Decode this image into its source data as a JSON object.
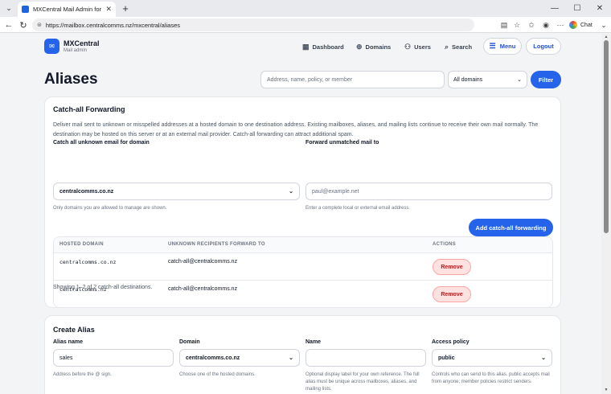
{
  "browser": {
    "tab_title": "MXCentral Mail Admin for CCL",
    "url": "https://mailbox.centralcomms.nz/mxcentral/aliases",
    "chat_label": "Chat"
  },
  "header": {
    "brand_name": "MXCentral",
    "brand_sub": "Mail admin",
    "nav": [
      {
        "label": "Dashboard",
        "icon": "dashboard-icon"
      },
      {
        "label": "Domains",
        "icon": "globe-icon"
      },
      {
        "label": "Users",
        "icon": "users-icon"
      },
      {
        "label": "Search",
        "icon": "search-icon"
      }
    ],
    "menu_label": "Menu",
    "logout_label": "Logout"
  },
  "page": {
    "title": "Aliases",
    "search_placeholder": "Address, name, policy, or member",
    "domain_filter_value": "All domains",
    "filter_label": "Filter"
  },
  "catchall": {
    "title": "Catch-all Forwarding",
    "description": "Deliver mail sent to unknown or misspelled addresses at a hosted domain to one destination address. Existing mailboxes, aliases, and mailing lists continue to receive their own mail normally. The destination may be hosted on this server or at an external mail provider. Catch-all forwarding can attract additional spam.",
    "domain_label": "Catch all unknown email for domain",
    "domain_value": "centralcomms.co.nz",
    "domain_help": "Only domains you are allowed to manage are shown.",
    "forward_label": "Forward unmatched mail to",
    "forward_placeholder": "paul@example.net",
    "forward_help": "Enter a complete local or external email address.",
    "add_label": "Add catch-all forwarding",
    "columns": [
      "HOSTED DOMAIN",
      "UNKNOWN RECIPIENTS FORWARD TO",
      "ACTIONS"
    ],
    "rows": [
      {
        "domain": "centralcomms.co.nz",
        "forward": "catch-all@centralcomms.nz",
        "action": "Remove"
      },
      {
        "domain": "centralcomms.nz",
        "forward": "catch-all@centralcomms.nz",
        "action": "Remove"
      }
    ],
    "count_text": "Showing 1–2 of 2 catch-all destinations."
  },
  "create": {
    "title": "Create Alias",
    "alias_label": "Alias name",
    "alias_value": "sales",
    "alias_help": "Address before the @ sign.",
    "domain_label": "Domain",
    "domain_value": "centralcomms.co.nz",
    "domain_help": "Choose one of the hosted domains.",
    "name_label": "Name",
    "name_value": "",
    "name_help": "Optional display label for your own reference. The full alias must be unique across mailboxes, aliases, and mailing lists.",
    "policy_label": "Access policy",
    "policy_value": "public",
    "policy_help": "Controls who can send to this alias. public accepts mail from anyone; member policies restrict senders."
  },
  "colors": {
    "accent": "#2563eb",
    "danger_bg": "#fee2e2",
    "danger_text": "#b91c1c"
  }
}
